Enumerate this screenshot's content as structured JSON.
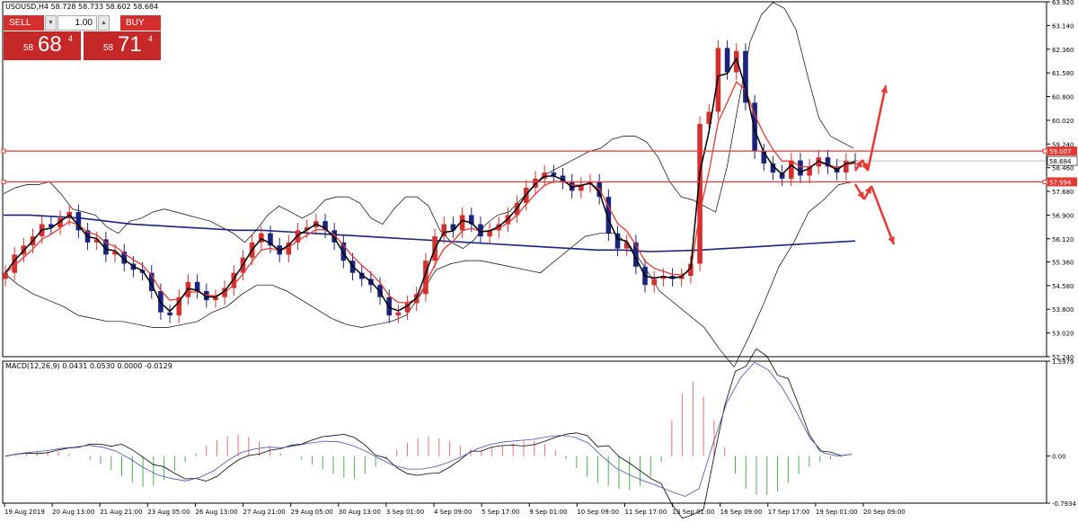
{
  "main_header": "USOUSD,H4  58.728 58.733 58.602 58.684",
  "trade_panel": {
    "sell_label": "SELL",
    "buy_label": "BUY",
    "volume": "1.00",
    "sell_prefix": "58",
    "sell_big": "68",
    "sell_sup": "4",
    "buy_prefix": "58",
    "buy_big": "71",
    "buy_sup": "4"
  },
  "macd_header": "MACD(12,26,9) 0.0431 0.0530 0.0000 -0.0129",
  "colors": {
    "bull": "#d32f2f",
    "bear": "#1a237e",
    "sma_slow": "#1a237e",
    "ema_red": "#e53935",
    "ema_black": "#000000",
    "bands": "#000000",
    "level": "#e53935",
    "macd_signal": "#3f51b5",
    "macd_hist_pos": "#e57373",
    "macd_hist_neg": "#4caf50"
  },
  "chart_data": [
    {
      "type": "candlestick",
      "symbol": "USOUSD",
      "timeframe": "H4",
      "y_ticks": [
        "63.920",
        "63.140",
        "62.360",
        "61.580",
        "60.800",
        "60.020",
        "59.240",
        "58.460",
        "57.680",
        "56.900",
        "56.120",
        "55.360",
        "54.580",
        "53.800",
        "53.020",
        "52.240"
      ],
      "ylim": [
        52.24,
        63.92
      ],
      "x_ticks": [
        "19 Aug 2019",
        "20 Aug 13:00",
        "21 Aug 21:00",
        "23 Aug 05:00",
        "26 Aug 13:00",
        "27 Aug 21:00",
        "29 Aug 05:00",
        "30 Aug 13:00",
        "3 Sep 01:00",
        "4 Sep 09:00",
        "5 Sep 17:00",
        "9 Sep 01:00",
        "10 Sep 09:00",
        "11 Sep 17:00",
        "13 Sep 01:00",
        "16 Sep 09:00",
        "17 Sep 17:00",
        "19 Sep 01:00",
        "20 Sep 09:00"
      ],
      "levels": [
        {
          "label": "59.007",
          "value": 59.007
        },
        {
          "label": "57.994",
          "value": 57.994
        }
      ],
      "current_price": {
        "label": "58.684",
        "value": 58.684
      },
      "close": [
        55.0,
        55.6,
        55.9,
        56.2,
        56.6,
        56.5,
        56.8,
        57.0,
        56.4,
        56.0,
        56.1,
        55.6,
        55.7,
        55.3,
        55.1,
        55.0,
        54.4,
        53.7,
        53.6,
        54.2,
        54.7,
        54.4,
        54.1,
        54.2,
        54.5,
        55.0,
        55.5,
        56.0,
        56.3,
        55.9,
        55.6,
        56.0,
        56.4,
        56.5,
        56.7,
        56.4,
        56.0,
        55.4,
        55.0,
        54.8,
        54.6,
        54.2,
        53.6,
        53.7,
        54.0,
        54.3,
        55.4,
        56.2,
        56.6,
        56.4,
        56.9,
        56.6,
        56.2,
        56.4,
        56.6,
        56.9,
        57.3,
        57.8,
        58.1,
        58.3,
        58.2,
        58.0,
        57.7,
        57.9,
        58.0,
        57.5,
        56.3,
        55.8,
        56.0,
        55.2,
        54.6,
        54.8,
        54.9,
        54.8,
        54.9,
        55.3,
        59.9,
        60.3,
        62.4,
        61.6,
        62.3,
        60.6,
        59.0,
        58.6,
        58.3,
        58.1,
        58.7,
        58.2,
        58.5,
        58.8,
        58.5,
        58.3,
        58.7,
        58.68
      ],
      "bollinger_upper": [
        57.6,
        57.8,
        57.9,
        57.9,
        58.0,
        57.6,
        57.1,
        57.0,
        56.9,
        56.5,
        56.3,
        56.7,
        56.8,
        57.0,
        57.1,
        57.0,
        56.9,
        56.8,
        56.7,
        56.5,
        56.3,
        56.0,
        56.4,
        56.9,
        57.2,
        57.0,
        56.8,
        57.0,
        57.4,
        57.5,
        57.5,
        57.3,
        56.8,
        56.6,
        57.1,
        57.5,
        57.5,
        57.2,
        56.4,
        56.0,
        55.8,
        56.1,
        56.6,
        56.9,
        57.0,
        57.4,
        57.8,
        58.2,
        58.4,
        58.6,
        58.8,
        59.0,
        59.1,
        59.4,
        59.5,
        59.5,
        59.3,
        58.8,
        58.0,
        57.5,
        57.4,
        57.2,
        57.0,
        58.5,
        60.6,
        62.6,
        63.5,
        63.9,
        63.7,
        63.0,
        61.5,
        60.1,
        59.5,
        59.3,
        59.1
      ],
      "bollinger_lower": [
        55.0,
        54.6,
        54.3,
        54.1,
        53.9,
        53.6,
        53.5,
        53.4,
        53.4,
        53.3,
        53.2,
        53.2,
        53.3,
        53.4,
        53.7,
        53.9,
        54.3,
        54.6,
        54.6,
        54.4,
        54.1,
        53.8,
        53.5,
        53.3,
        53.2,
        53.3,
        53.4,
        53.6,
        54.3,
        55.1,
        55.3,
        55.4,
        55.4,
        55.3,
        55.2,
        55.1,
        55.0,
        55.4,
        55.8,
        56.2,
        56.3,
        56.3,
        55.9,
        55.2,
        54.4,
        54.0,
        53.6,
        53.2,
        52.5,
        51.9,
        52.9,
        54.0,
        55.2,
        56.0,
        57.0,
        57.4,
        57.9,
        58.0
      ],
      "sma_slow": [
        56.9,
        56.9,
        56.85,
        56.8,
        56.7,
        56.6,
        56.55,
        56.5,
        56.45,
        56.4,
        56.4,
        56.35,
        56.3,
        56.25,
        56.2,
        56.15,
        56.1,
        56.05,
        56.0,
        55.95,
        55.9,
        55.85,
        55.8,
        55.75,
        55.75,
        55.7,
        55.72,
        55.75,
        55.8,
        55.85,
        55.9,
        55.95,
        56.0,
        56.05
      ]
    },
    {
      "type": "macd",
      "title": "MACD(12,26,9) 0.0431 0.0530 0.0000 -0.0129",
      "params": [
        12,
        26,
        9
      ],
      "y_ticks": [
        "1.5979",
        "0.00",
        "-0.7934"
      ],
      "ylim": [
        -0.7934,
        1.5979
      ],
      "histogram": [
        0.01,
        0.03,
        0.06,
        0.08,
        0.1,
        0.08,
        0.04,
        0.0,
        -0.06,
        -0.14,
        -0.24,
        -0.34,
        -0.44,
        -0.52,
        -0.5,
        -0.4,
        -0.25,
        -0.1,
        0.05,
        0.18,
        0.27,
        0.33,
        0.36,
        0.32,
        0.25,
        0.15,
        0.05,
        0.0,
        -0.06,
        -0.14,
        -0.22,
        -0.3,
        -0.36,
        -0.38,
        -0.3,
        -0.18,
        -0.05,
        0.1,
        0.22,
        0.3,
        0.33,
        0.3,
        0.25,
        0.18,
        0.12,
        0.1,
        0.14,
        0.18,
        0.22,
        0.26,
        0.25,
        0.2,
        0.1,
        -0.05,
        -0.2,
        -0.35,
        -0.45,
        -0.5,
        -0.55,
        -0.57,
        -0.5,
        -0.35,
        -0.1,
        0.6,
        1.05,
        1.25,
        1.0,
        0.6,
        0.15,
        -0.3,
        -0.55,
        -0.65,
        -0.66,
        -0.6,
        -0.45,
        -0.3,
        -0.18,
        -0.1,
        -0.05,
        -0.02,
        0.0
      ],
      "signal": [
        0.0,
        0.04,
        0.07,
        0.09,
        0.13,
        0.15,
        0.18,
        0.15,
        0.08,
        -0.05,
        -0.2,
        -0.32,
        -0.38,
        -0.42,
        -0.36,
        -0.25,
        -0.08,
        0.06,
        0.12,
        0.15,
        0.14,
        0.18,
        0.22,
        0.25,
        0.24,
        0.18,
        0.08,
        -0.05,
        -0.16,
        -0.22,
        -0.22,
        -0.18,
        -0.1,
        0.0,
        0.12,
        0.2,
        0.24,
        0.26,
        0.28,
        0.32,
        0.35,
        0.32,
        0.22,
        0.0,
        -0.2,
        -0.32,
        -0.42,
        -0.5,
        -0.6,
        -0.68,
        -0.55,
        0.2,
        0.9,
        1.32,
        1.58,
        1.45,
        1.15,
        0.75,
        0.3,
        0.05,
        0.0,
        0.03
      ]
    }
  ]
}
